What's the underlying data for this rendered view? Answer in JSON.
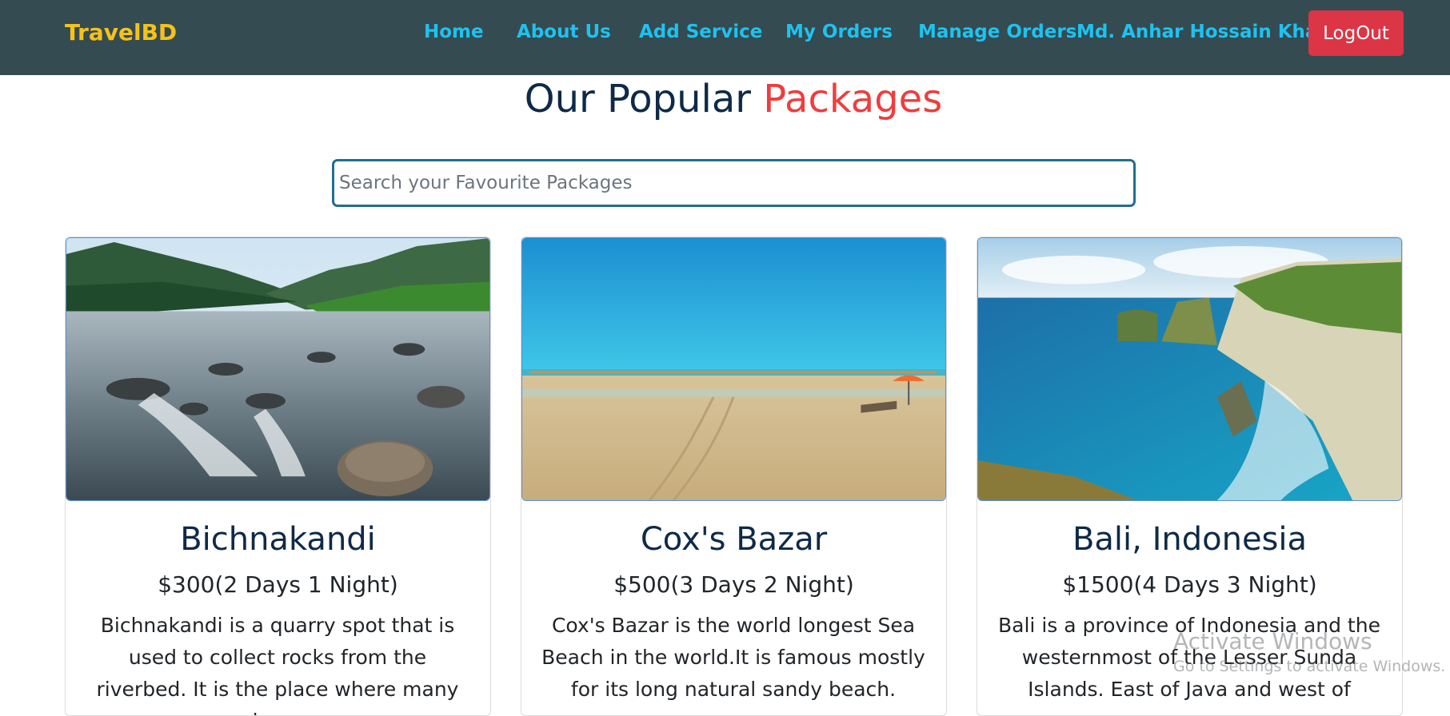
{
  "navbar": {
    "brand": "TravelBD",
    "links": [
      "Home",
      "About Us",
      "Add Service",
      "My Orders",
      "Manage Orders",
      "Md. Anhar Hossain Khan"
    ],
    "logout_label": "LogOut",
    "colors": {
      "background": "#344b51",
      "brand": "#f5c21b",
      "link": "#1ec2f0",
      "logout": "#dc3545"
    }
  },
  "page": {
    "heading_main": "Our Popular",
    "heading_accent": "Packages",
    "colors": {
      "heading": "#0e2a47",
      "accent": "#ef3d3d"
    }
  },
  "search": {
    "placeholder": "Search your Favourite Packages",
    "value": ""
  },
  "cards": [
    {
      "image": "river-rocks-mountains",
      "title": "Bichnakandi",
      "price": "$300(2 Days 1 Night)",
      "description": "Bichnakandi is a quarry spot that is used to collect rocks from the riverbed. It is the place where many layer"
    },
    {
      "image": "sandy-beach-umbrellas",
      "title": "Cox's Bazar",
      "price": "$500(3 Days 2 Night)",
      "description": "Cox's Bazar is the world longest Sea Beach in the world.It is famous mostly for its long natural sandy beach."
    },
    {
      "image": "coastal-cliffs-ocean",
      "title": "Bali, Indonesia",
      "price": "$1500(4 Days 3 Night)",
      "description": "Bali is a province of Indonesia and the westernmost of the Lesser Sunda Islands. East of Java and west of"
    }
  ],
  "watermark": {
    "title": "Activate Windows",
    "subtitle": "Go to Settings to activate Windows."
  }
}
